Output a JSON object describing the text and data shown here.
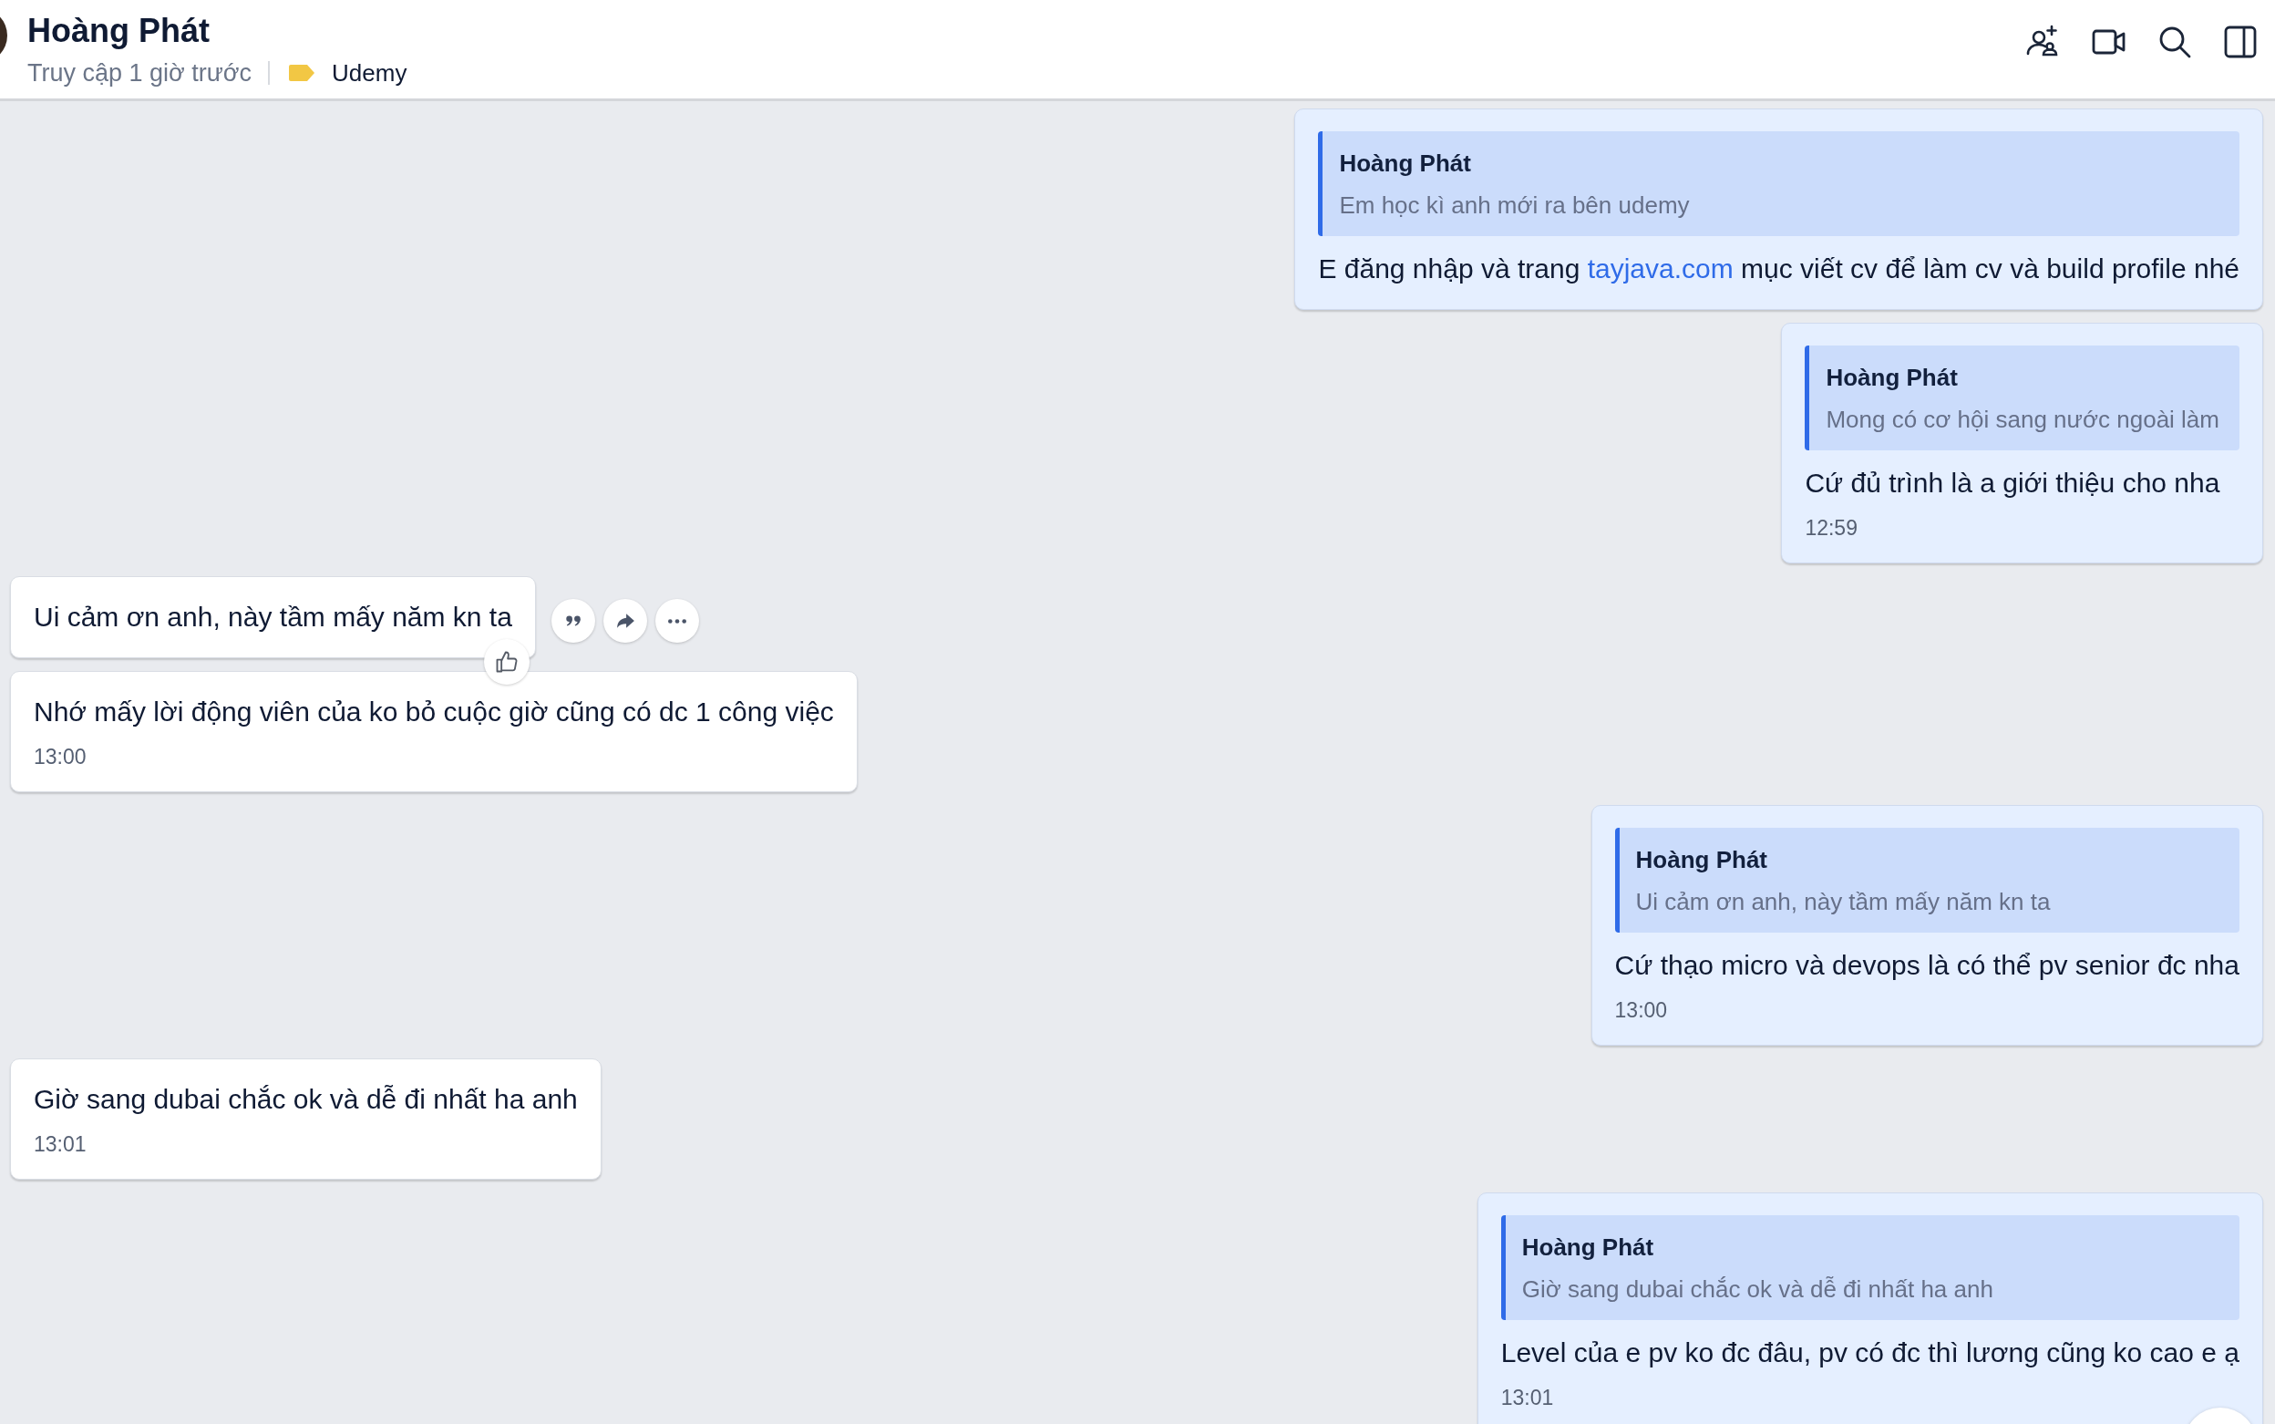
{
  "header": {
    "name": "Hoàng Phát",
    "status": "Truy cập 1 giờ trước",
    "tag": "Udemy"
  },
  "messages": [
    {
      "kind": "sent",
      "hovered": false,
      "quote": {
        "author": "Hoàng Phát",
        "text": "Em học kì anh mới ra bên udemy"
      },
      "parts": [
        {
          "kind": "text",
          "text": "E đăng nhập và trang "
        },
        {
          "kind": "link",
          "text": "tayjava.com"
        },
        {
          "kind": "text",
          "text": " mục viết cv để làm cv và build profile nhé"
        }
      ]
    },
    {
      "kind": "sent",
      "hovered": false,
      "quote": {
        "author": "Hoàng Phát",
        "text": "Mong có cơ hội sang nước ngoài làm"
      },
      "parts": [
        {
          "kind": "text",
          "text": "Cứ đủ trình là a giới thiệu cho nha"
        }
      ],
      "time": "12:59"
    },
    {
      "kind": "received",
      "hovered": true,
      "parts": [
        {
          "kind": "text",
          "text": "Ui cảm ơn anh, này tầm mấy năm kn ta"
        }
      ]
    },
    {
      "kind": "received",
      "hovered": false,
      "parts": [
        {
          "kind": "text",
          "text": "Nhớ mấy lời động viên của ko bỏ cuộc giờ cũng có dc 1 công việc"
        }
      ],
      "time": "13:00"
    },
    {
      "kind": "sent",
      "hovered": false,
      "quote": {
        "author": "Hoàng Phát",
        "text": "Ui cảm ơn anh, này tầm mấy năm kn ta"
      },
      "parts": [
        {
          "kind": "text",
          "text": "Cứ thạo micro và devops là có thể pv senior đc nha"
        }
      ],
      "time": "13:00"
    },
    {
      "kind": "received",
      "hovered": false,
      "parts": [
        {
          "kind": "text",
          "text": "Giờ sang dubai chắc ok và dễ đi nhất ha anh"
        }
      ],
      "time": "13:01"
    },
    {
      "kind": "sent",
      "hovered": false,
      "quote": {
        "author": "Hoàng Phát",
        "text": "Giờ sang dubai chắc ok và dễ đi nhất ha anh"
      },
      "parts": [
        {
          "kind": "text",
          "text": "Level của e pv ko đc đâu, pv có đc thì lương cũng ko cao e ạ"
        }
      ],
      "time": "13:01"
    }
  ]
}
